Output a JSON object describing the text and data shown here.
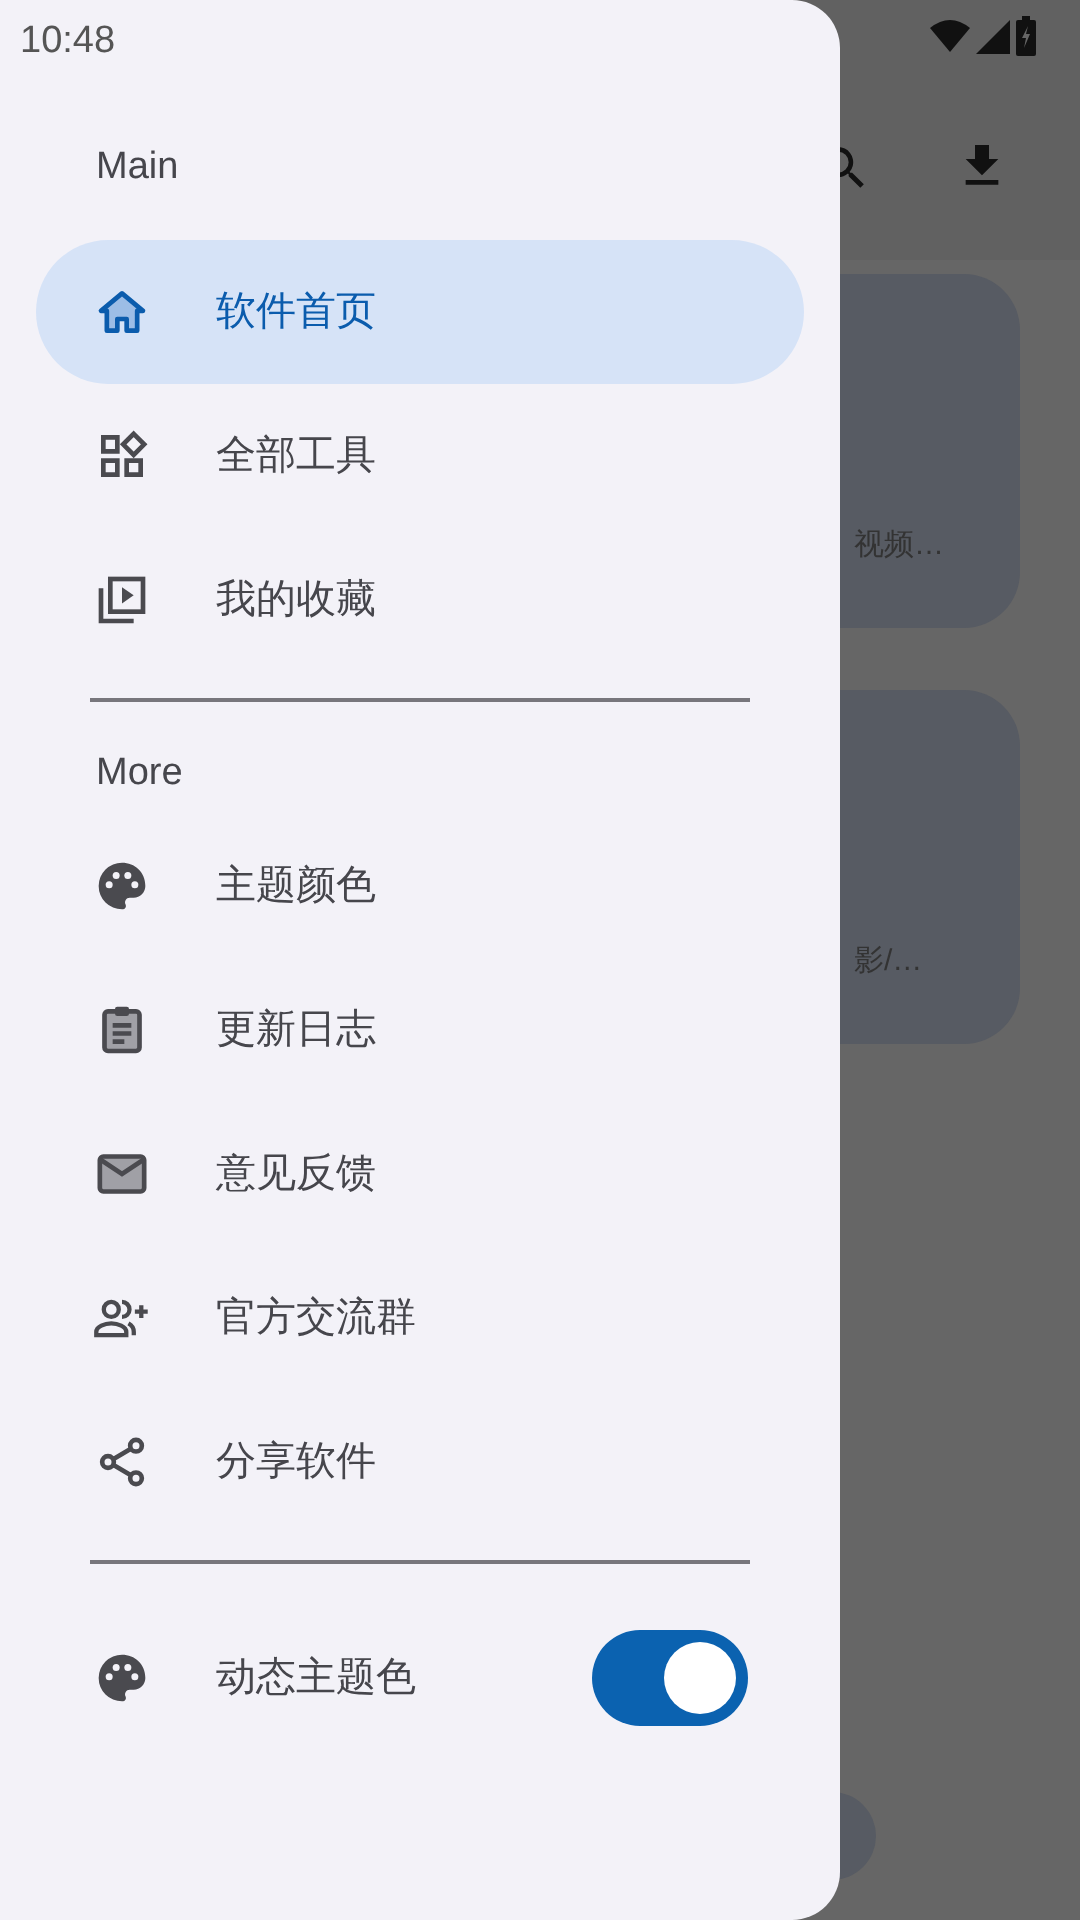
{
  "status_bar": {
    "time": "10:48"
  },
  "background_app": {
    "cards": [
      {
        "subtitle": "视频…"
      },
      {
        "subtitle": "影/…"
      }
    ]
  },
  "drawer": {
    "sections": [
      {
        "header": "Main",
        "items": [
          {
            "label": "软件首页",
            "selected": true
          },
          {
            "label": "全部工具",
            "selected": false
          },
          {
            "label": "我的收藏",
            "selected": false
          }
        ]
      },
      {
        "header": "More",
        "items": [
          {
            "label": "主题颜色",
            "selected": false
          },
          {
            "label": "更新日志",
            "selected": false
          },
          {
            "label": "意见反馈",
            "selected": false
          },
          {
            "label": "官方交流群",
            "selected": false
          },
          {
            "label": "分享软件",
            "selected": false
          }
        ]
      }
    ],
    "toggles": [
      {
        "label": "动态主题色",
        "on": true
      }
    ]
  }
}
